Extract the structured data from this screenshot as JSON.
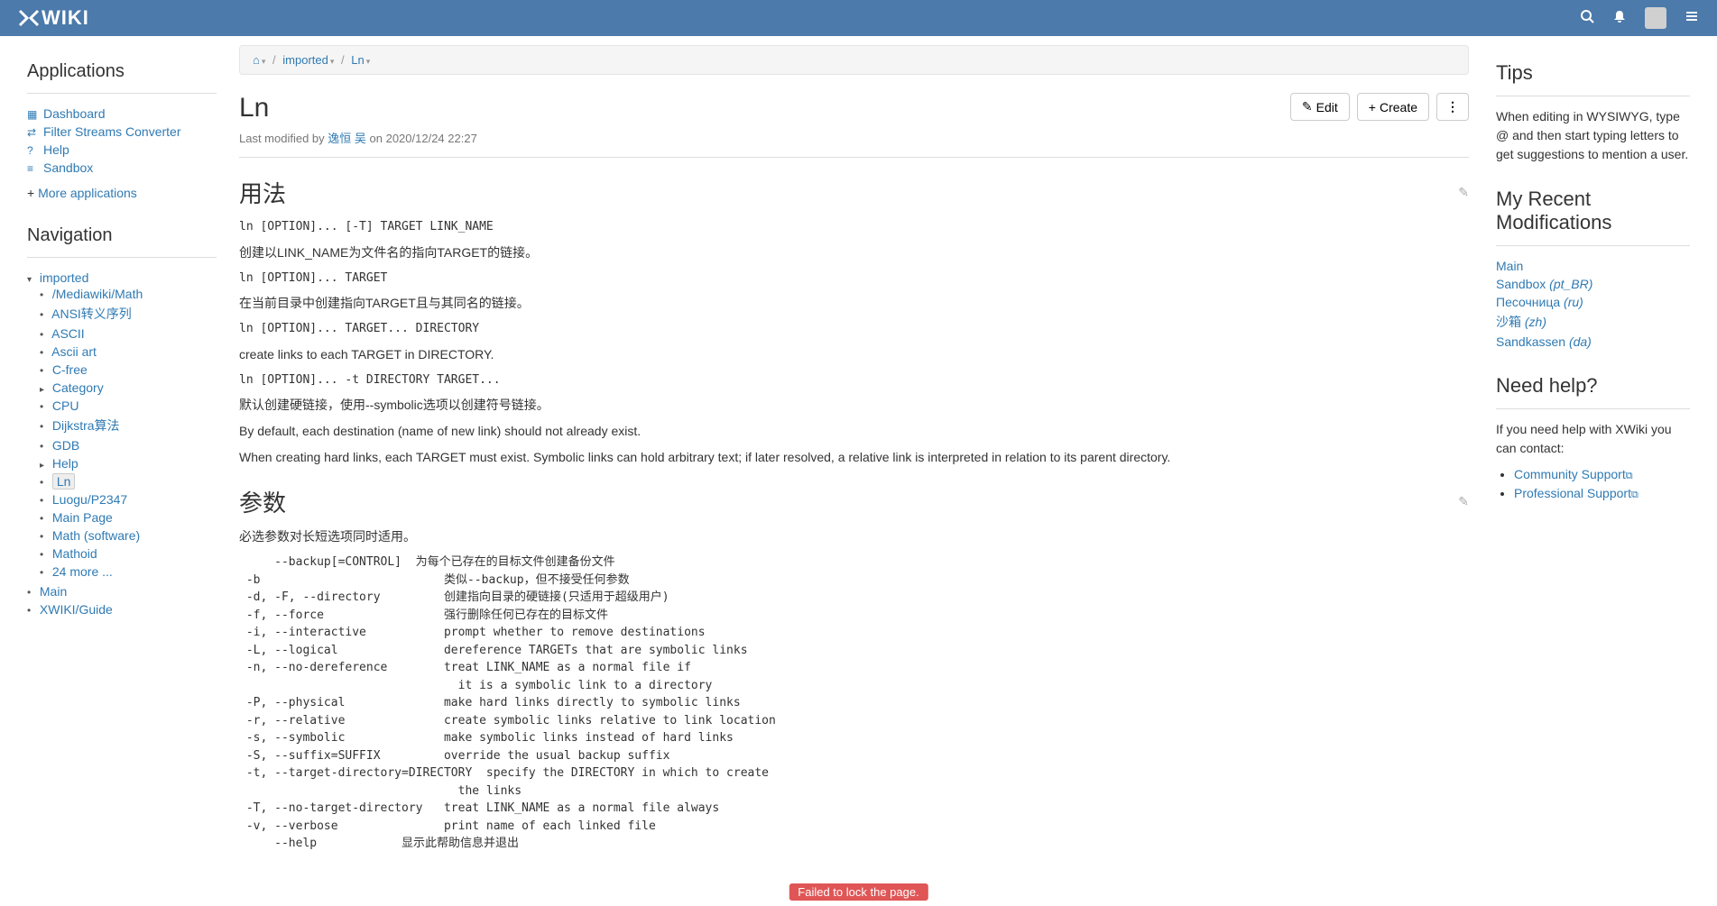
{
  "header": {
    "logo_text": "WIKI"
  },
  "left": {
    "apps_heading": "Applications",
    "apps": [
      {
        "icon": "▦",
        "label": "Dashboard"
      },
      {
        "icon": "⇄",
        "label": "Filter Streams Converter"
      },
      {
        "icon": "?",
        "label": "Help"
      },
      {
        "icon": "≡",
        "label": "Sandbox"
      }
    ],
    "more_apps": "More applications",
    "nav_heading": "Navigation",
    "nav_root": "imported",
    "nav_items": [
      "/Mediawiki/Math",
      "ANSI转义序列",
      "ASCII",
      "Ascii art",
      "C-free",
      "Category",
      "CPU",
      "Dijkstra算法",
      "GDB",
      "Help",
      "Ln",
      "Luogu/P2347",
      "Main Page",
      "Math (software)",
      "Mathoid",
      "24 more ..."
    ],
    "nav_bottom": [
      "Main",
      "XWIKI/Guide"
    ]
  },
  "breadcrumb": {
    "home": "⌂",
    "items": [
      "imported",
      "Ln"
    ]
  },
  "actions": {
    "edit": "Edit",
    "create": "Create"
  },
  "doc": {
    "title": "Ln",
    "modified_prefix": "Last modified by ",
    "modified_author": "逸恒 吴",
    "modified_suffix": " on 2020/12/24 22:27",
    "section1_title": "用法",
    "s1_code1": "ln [OPTION]... [-T] TARGET LINK_NAME",
    "s1_p1": "创建以LINK_NAME为文件名的指向TARGET的链接。",
    "s1_code2": "ln [OPTION]... TARGET",
    "s1_p2": "在当前目录中创建指向TARGET且与其同名的链接。",
    "s1_code3": "ln [OPTION]... TARGET... DIRECTORY",
    "s1_p3": "create links to each TARGET in DIRECTORY.",
    "s1_code4": "ln [OPTION]... -t DIRECTORY TARGET...",
    "s1_p4": "默认创建硬链接，使用--symbolic选项以创建符号链接。",
    "s1_p5": "By default, each destination (name of new link) should not already exist.",
    "s1_p6": "When creating hard links, each TARGET must exist. Symbolic links can hold arbitrary text; if later resolved, a relative link is interpreted in relation to its parent directory.",
    "section2_title": "参数",
    "s2_p1": "必选参数对长短选项同时适用。",
    "s2_pre": "     --backup[=CONTROL]  为每个已存在的目标文件创建备份文件\n -b                          类似--backup，但不接受任何参数\n -d, -F, --directory         创建指向目录的硬链接(只适用于超级用户)\n -f, --force                 强行删除任何已存在的目标文件\n -i, --interactive           prompt whether to remove destinations\n -L, --logical               dereference TARGETs that are symbolic links\n -n, --no-dereference        treat LINK_NAME as a normal file if\n                               it is a symbolic link to a directory\n -P, --physical              make hard links directly to symbolic links\n -r, --relative              create symbolic links relative to link location\n -s, --symbolic              make symbolic links instead of hard links\n -S, --suffix=SUFFIX         override the usual backup suffix\n -t, --target-directory=DIRECTORY  specify the DIRECTORY in which to create\n                               the links\n -T, --no-target-directory   treat LINK_NAME as a normal file always\n -v, --verbose               print name of each linked file\n     --help            显示此帮助信息并退出"
  },
  "right": {
    "tips_heading": "Tips",
    "tips_text": "When editing in WYSIWYG, type @ and then start typing letters to get suggestions to mention a user.",
    "recent_heading": "My Recent Modifications",
    "recent": [
      {
        "label": "Main",
        "lang": ""
      },
      {
        "label": "Sandbox",
        "lang": " (pt_BR)"
      },
      {
        "label": "Песочница",
        "lang": " (ru)"
      },
      {
        "label": "沙箱",
        "lang": " (zh)"
      },
      {
        "label": "Sandkassen",
        "lang": " (da)"
      }
    ],
    "help_heading": "Need help?",
    "help_text": "If you need help with XWiki you can contact:",
    "help_links": [
      "Community Support",
      "Professional Support"
    ]
  },
  "banner": "Failed to lock the page."
}
